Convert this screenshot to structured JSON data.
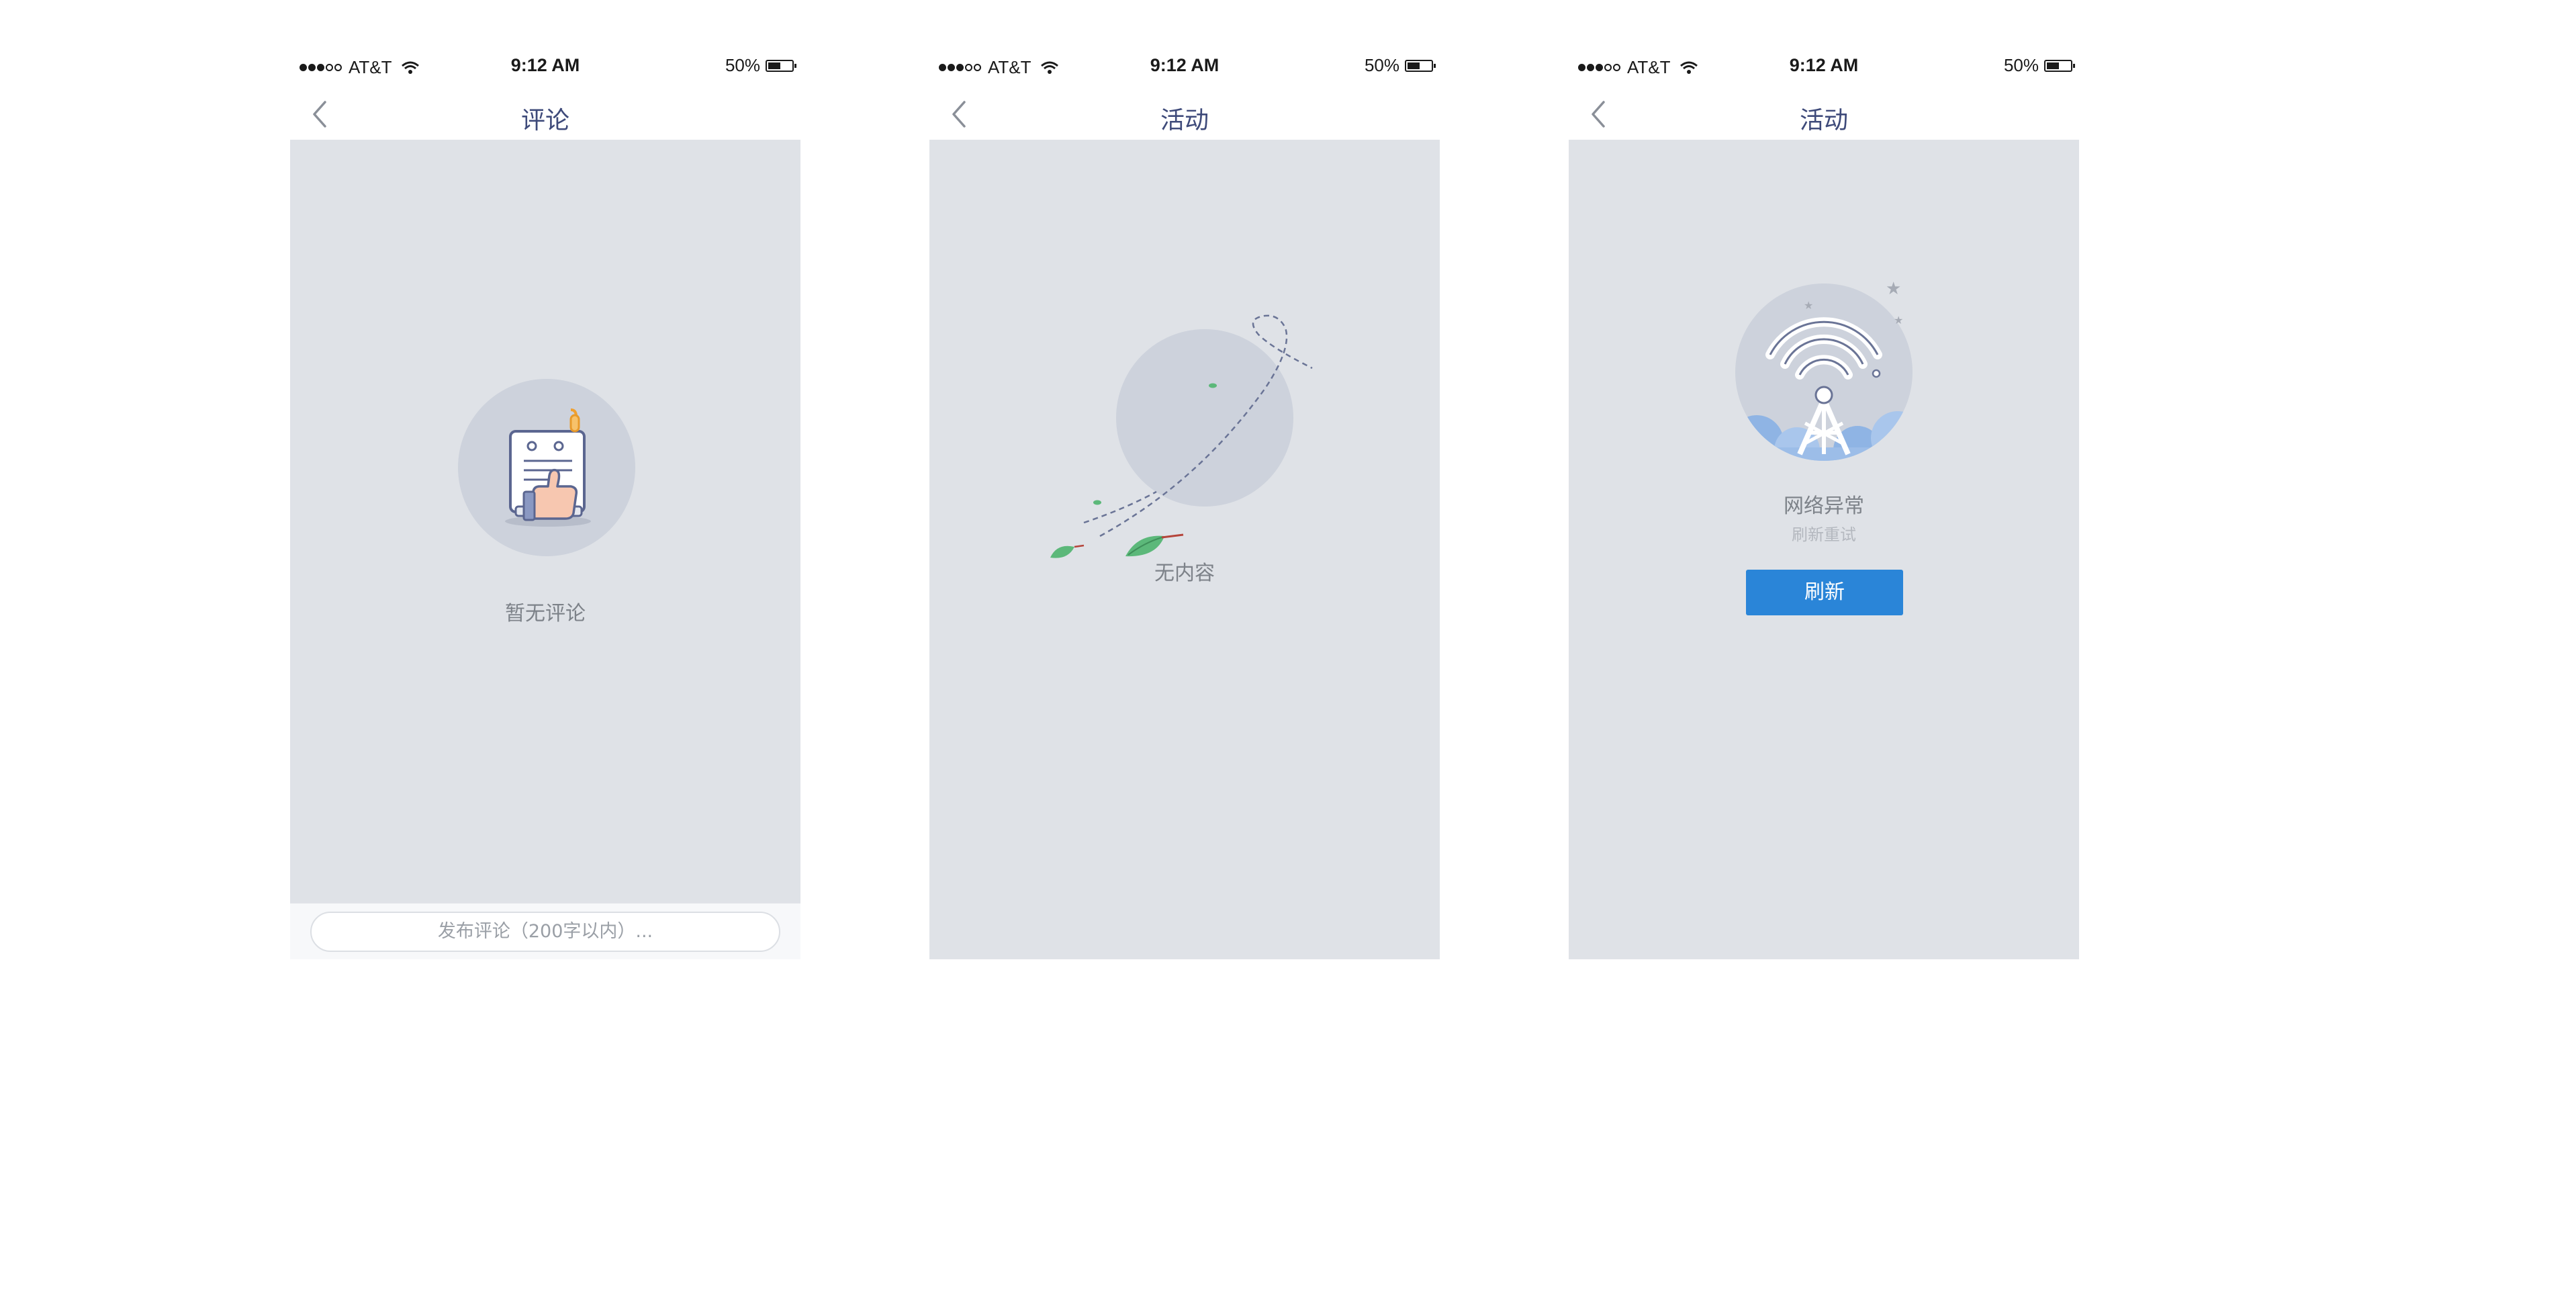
{
  "status_bar": {
    "carrier": "AT&T",
    "time": "9:12 AM",
    "battery": "50%"
  },
  "screens": [
    {
      "title": "评论",
      "empty_text": "暂无评论",
      "comment_placeholder": "发布评论（200字以内）..."
    },
    {
      "title": "活动",
      "empty_text": "无内容"
    },
    {
      "title": "活动",
      "error_text": "网络异常",
      "sub_text": "刷新重试",
      "refresh_label": "刷新"
    }
  ],
  "colors": {
    "title": "#3e4a7a",
    "content_bg": "#dfe2e7",
    "accent": "#2a85d8",
    "leaf": "#5cb87a"
  },
  "icons": [
    "back-icon",
    "wifi-icon",
    "battery-icon",
    "notepad-thumbs-up-icon",
    "flying-leaves-icon",
    "signal-tower-icon"
  ]
}
